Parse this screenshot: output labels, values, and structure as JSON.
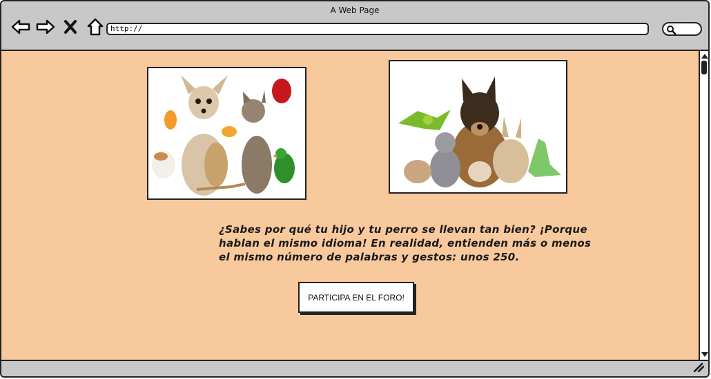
{
  "window": {
    "title": "A Web Page"
  },
  "toolbar": {
    "back_icon": "arrow-left-icon",
    "forward_icon": "arrow-right-icon",
    "stop_icon": "close-icon",
    "home_icon": "home-icon",
    "url": "http://",
    "search_icon": "search-icon"
  },
  "content": {
    "background": "#f8c99c",
    "image_left": "pets-image",
    "image_right": "pets-image",
    "paragraph": "¿Sabes por qué tu hijo y tu perro se llevan tan bien? ¡Porque hablan el mismo idioma! En realidad, entienden más o menos el mismo número de palabras y gestos: unos 250.",
    "button_label": "PARTICIPA EN EL FORO!"
  }
}
